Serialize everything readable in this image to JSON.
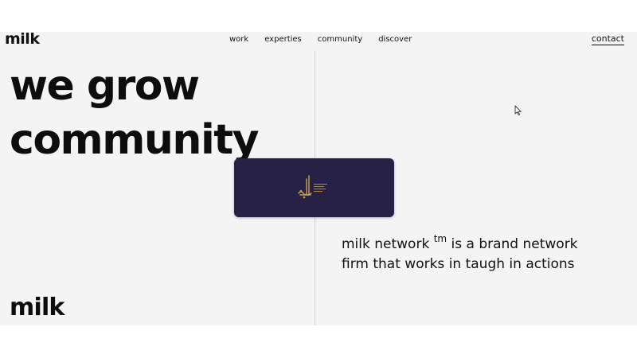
{
  "header": {
    "logo": "milk",
    "nav": [
      "work",
      "experties",
      "community",
      "discover"
    ],
    "contact_label": "contact"
  },
  "hero": {
    "headline_line1": "we grow",
    "headline_line2": "community"
  },
  "card": {
    "background_color": "#272245",
    "emblem_color": "#c9a24a",
    "emblem": "arabic-calligraphy-logo"
  },
  "tagline": {
    "before": "milk network ",
    "superscript": "tm",
    "after": " is a brand network firm that works in taugh in actions"
  },
  "footer": {
    "logo": "milk"
  }
}
